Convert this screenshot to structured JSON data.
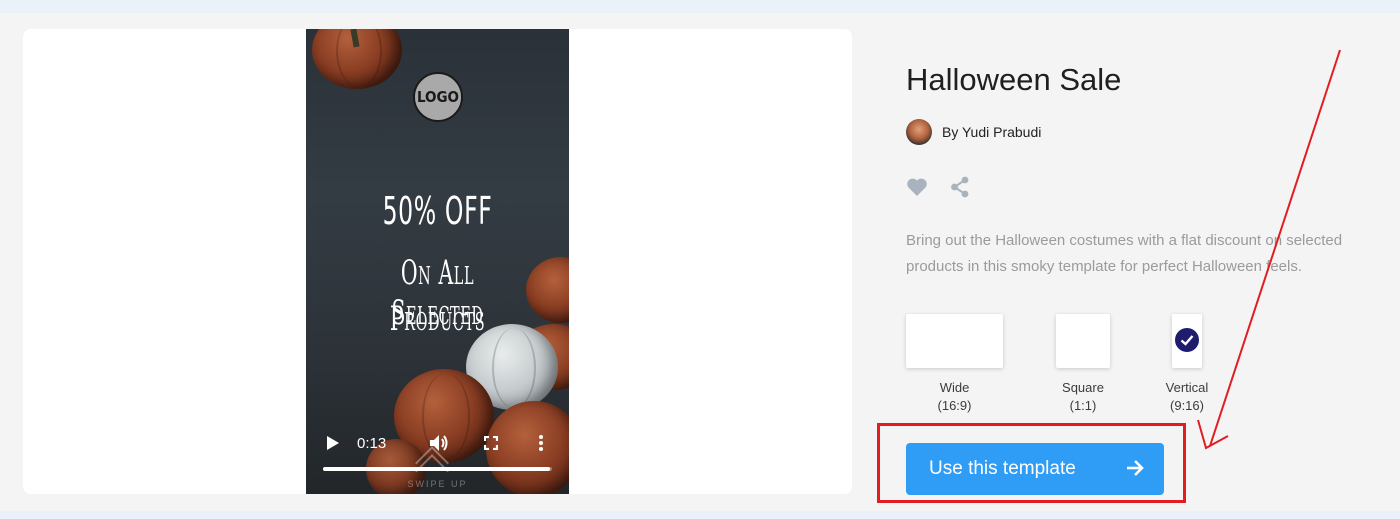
{
  "template": {
    "title": "Halloween Sale",
    "author": "By Yudi Prabudi",
    "description_line1": "Bring out the Halloween costumes with a flat discount on selected",
    "description_line2": "products in this smoky template for perfect Halloween feels."
  },
  "preview": {
    "logo_text": "LOGO",
    "headline": "50% OFF",
    "subline1": "On All Selected",
    "subline2": "Products",
    "swipe_text": "SWIPE UP",
    "time": "0:13",
    "progress": 0.99
  },
  "formats": [
    {
      "name": "Wide",
      "ratio": "(16:9)",
      "selected": false
    },
    {
      "name": "Square",
      "ratio": "(1:1)",
      "selected": false
    },
    {
      "name": "Vertical",
      "ratio": "(9:16)",
      "selected": true
    }
  ],
  "cta": {
    "label": "Use this template"
  },
  "icons": {
    "like": "heart-icon",
    "share": "share-icon",
    "play": "play-icon",
    "volume": "volume-icon",
    "fullscreen": "fullscreen-icon",
    "more": "more-vertical-icon",
    "arrow": "arrow-right-icon",
    "check": "check-icon"
  },
  "colors": {
    "cta": "#2f9cf6",
    "check": "#1f1c6e",
    "annotation": "#e11d21",
    "icon_gray": "#a8b3bd"
  }
}
